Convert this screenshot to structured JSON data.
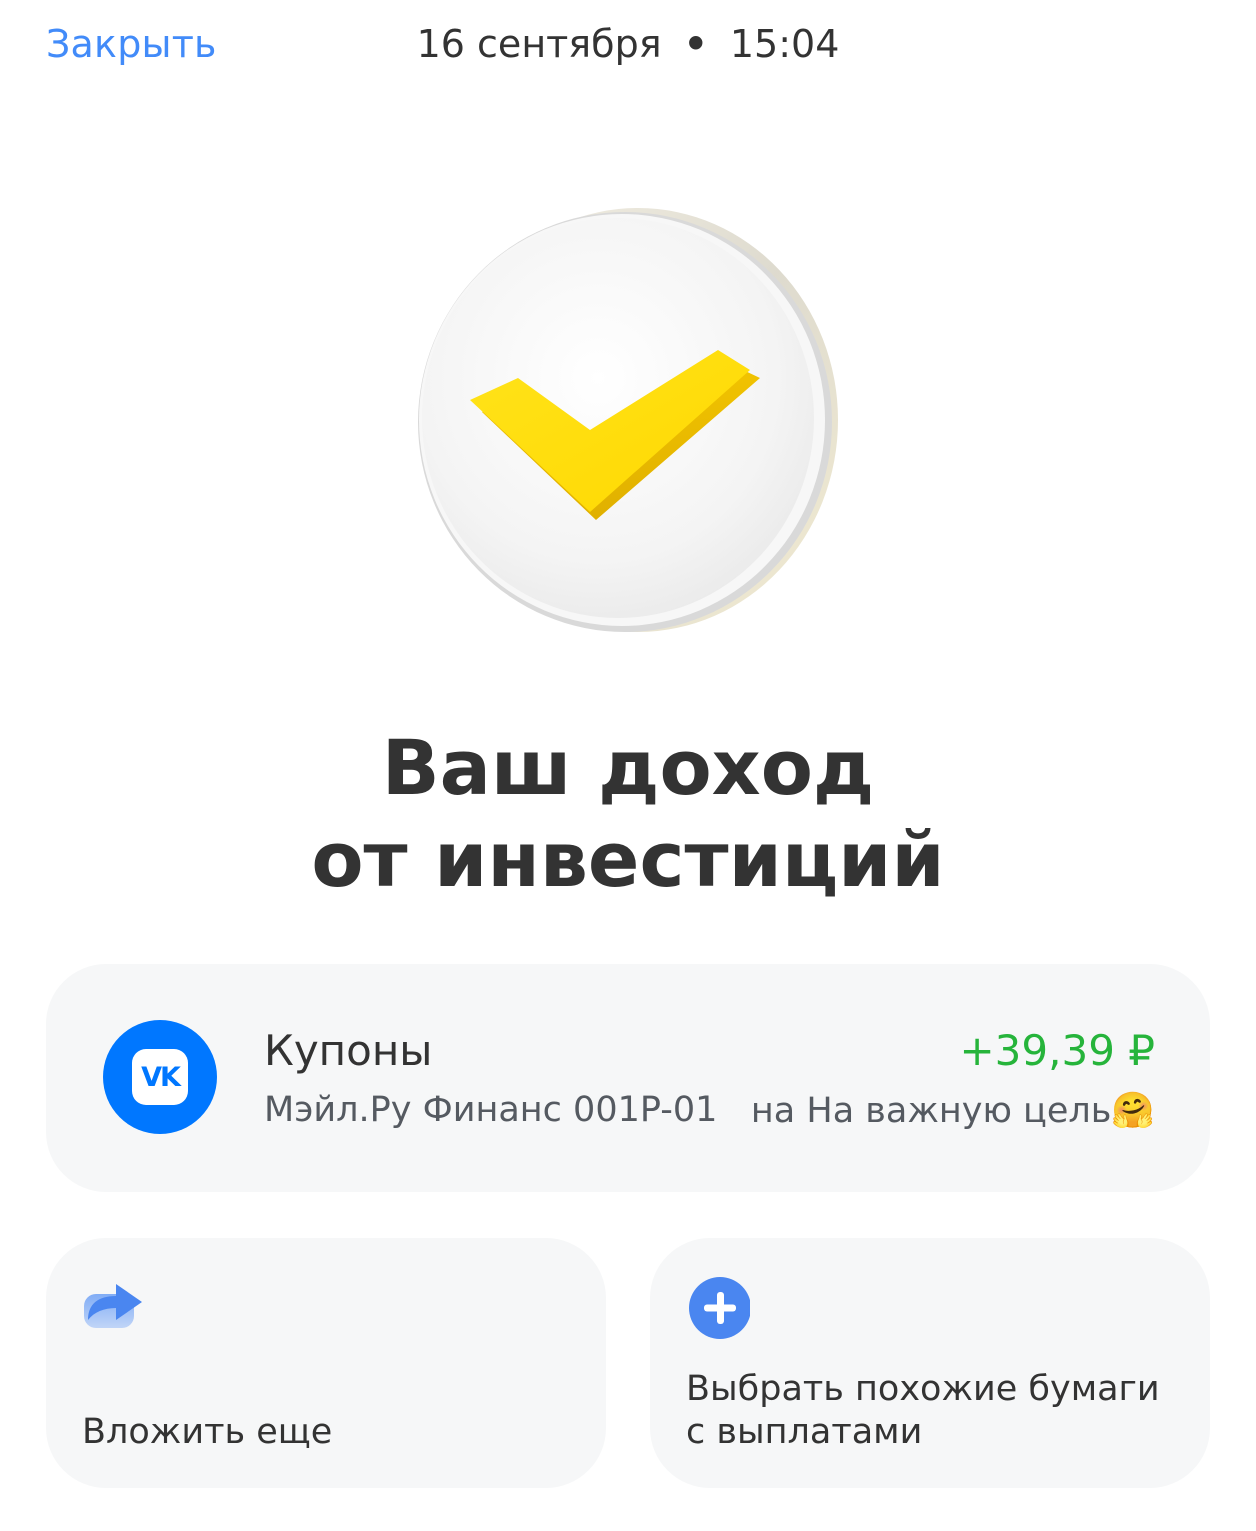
{
  "header": {
    "close_label": "Закрыть",
    "date": "16 сентября",
    "separator": "•",
    "time": "15:04"
  },
  "hero": {
    "icon": "yellow-checkmark-badge-icon"
  },
  "title": {
    "line1": "Ваш доход",
    "line2": "от инвестиций"
  },
  "operation": {
    "logo_icon": "vk-logo-icon",
    "logo_text": "VK",
    "type": "Купоны",
    "security": "Мэйл.Ру Финанс 001P-01",
    "amount": "+39,39 ₽",
    "destination": "на На важную цель🤗",
    "amount_color": "#26b43b"
  },
  "actions": [
    {
      "icon": "share-arrow-icon",
      "label": "Вложить еще"
    },
    {
      "icon": "plus-circle-icon",
      "label": "Выбрать похожие бумаги с выплатами"
    }
  ],
  "colors": {
    "accent": "#428bf9",
    "brand_yellow": "#ffdd2d",
    "card_bg": "#f6f7f8",
    "positive": "#26b43b"
  }
}
